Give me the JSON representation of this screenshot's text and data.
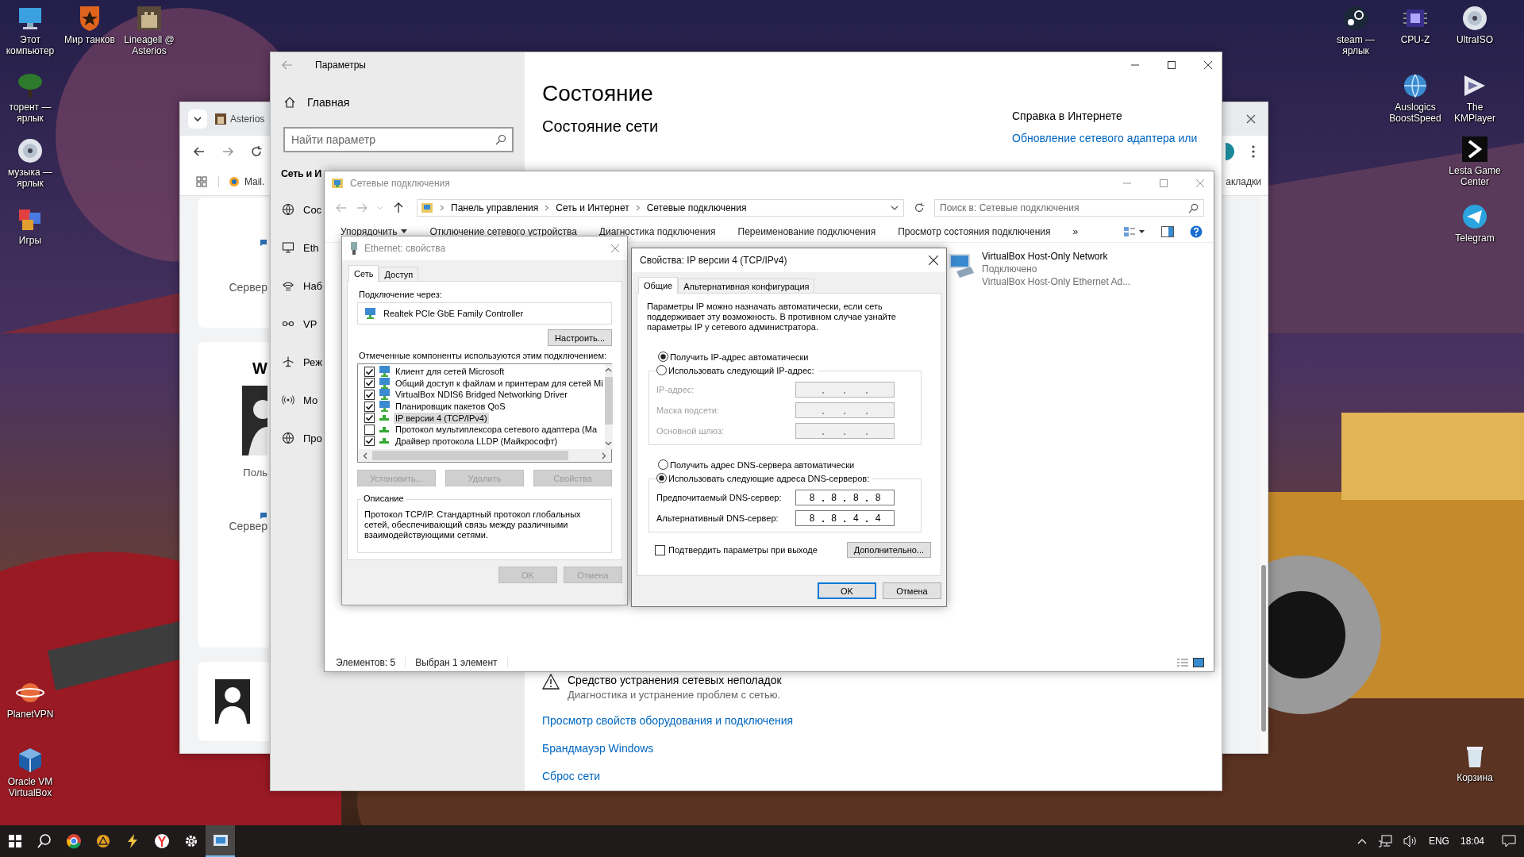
{
  "desktop_icons": [
    {
      "label": "Этот компьютер",
      "kind": "monitor"
    },
    {
      "label": "Мир танков",
      "kind": "star-shield"
    },
    {
      "label": "Lineagell @ Asterios",
      "kind": "castle"
    },
    {
      "label": "торент — ярлык",
      "kind": "tree"
    },
    {
      "label": "музыка — ярлык",
      "kind": "disc"
    },
    {
      "label": "Игры",
      "kind": "blocks"
    },
    {
      "label": "PlanetVPN",
      "kind": "planet"
    },
    {
      "label": "Oracle VM VirtualBox",
      "kind": "cube"
    },
    {
      "label": "steam — ярлык",
      "kind": "steam"
    },
    {
      "label": "CPU-Z",
      "kind": "chip"
    },
    {
      "label": "UltraISO",
      "kind": "disc"
    },
    {
      "label": "Auslogics BoostSpeed",
      "kind": "globe"
    },
    {
      "label": "The KMPlayer",
      "kind": "play"
    },
    {
      "label": "Lesta Game Center",
      "kind": "chevron"
    },
    {
      "label": "Telegram",
      "kind": "plane"
    },
    {
      "label": "Корзина",
      "kind": "bin"
    }
  ],
  "browser": {
    "tab": "Asterios",
    "bookmark": "Mail.",
    "bookmarks_end": "акладки",
    "cards": [
      {
        "server": "Сервер"
      },
      {
        "heading": "W",
        "user": "Поль",
        "server": "Сервер"
      }
    ]
  },
  "settings": {
    "title": "Параметры",
    "home": "Главная",
    "search_placeholder": "Найти параметр",
    "section": "Сеть и И",
    "nav": [
      {
        "label": "Сос",
        "kind": "globe"
      },
      {
        "label": "Eth",
        "kind": "ethernet"
      },
      {
        "label": "Наб",
        "kind": "dialup"
      },
      {
        "label": "VP",
        "kind": "vpn"
      },
      {
        "label": "Реж",
        "kind": "plane"
      },
      {
        "label": "Мо",
        "kind": "hotspot"
      },
      {
        "label": "Про",
        "kind": "globe"
      }
    ],
    "heading": "Состояние",
    "subheading": "Состояние сети",
    "help_title": "Справка в Интернете",
    "help_link": "Обновление сетевого адаптера или",
    "troubleshoot": {
      "title": "Средство устранения сетевых неполадок",
      "subtitle": "Диагностика и устранение проблем с сетью."
    },
    "links": [
      "Просмотр свойств оборудования и подключения",
      "Брандмауэр Windows",
      "Сброс сети"
    ]
  },
  "connections": {
    "title": "Сетевые подключения",
    "path": [
      "Панель управления",
      "Сеть и Интернет",
      "Сетевые подключения"
    ],
    "search_placeholder": "Поиск в: Сетевые подключения",
    "commands": [
      "Упорядочить",
      "Отключение сетевого устройства",
      "Диагностика подключения",
      "Переименование подключения",
      "Просмотр состояния подключения",
      "»"
    ],
    "item": {
      "name": "VirtualBox Host-Only Network",
      "status": "Подключено",
      "device": "VirtualBox Host-Only Ethernet Ad..."
    },
    "status": [
      "Элементов: 5",
      "Выбран 1 элемент"
    ]
  },
  "ethernet_dialog": {
    "title": "Ethernet: свойства",
    "tabs": [
      {
        "label": "Сеть",
        "selected": true
      },
      {
        "label": "Доступ",
        "selected": false
      }
    ],
    "connect_label": "Подключение через:",
    "adapter": "Realtek PCIe GbE Family Controller",
    "configure": "Настроить...",
    "components_label": "Отмеченные компоненты используются этим подключением:",
    "components": [
      {
        "name": "Клиент для сетей Microsoft",
        "kind": "client",
        "checked": true,
        "selected": false
      },
      {
        "name": "Общий доступ к файлам и принтерам для сетей Mi",
        "kind": "client",
        "checked": true,
        "selected": false
      },
      {
        "name": "VirtualBox NDIS6 Bridged Networking Driver",
        "kind": "client",
        "checked": true,
        "selected": false
      },
      {
        "name": "Планировщик пакетов QoS",
        "kind": "client",
        "checked": true,
        "selected": false
      },
      {
        "name": "IP версии 4 (TCP/IPv4)",
        "kind": "protocol",
        "checked": true,
        "selected": true
      },
      {
        "name": "Протокол мультиплексора сетевого адаптера (Ма",
        "kind": "protocol",
        "checked": false,
        "selected": false
      },
      {
        "name": "Драйвер протокола LLDP (Майкрософт)",
        "kind": "protocol",
        "checked": true,
        "selected": false
      }
    ],
    "buttons": [
      {
        "label": "Установить...",
        "disabled": true
      },
      {
        "label": "Удалить",
        "disabled": true
      },
      {
        "label": "Свойства",
        "disabled": true
      }
    ],
    "description_title": "Описание",
    "description": "Протокол TCP/IP. Стандартный протокол глобальных сетей, обеспечивающий связь между различными взаимодействующими сетями.",
    "footer": [
      {
        "label": "OK",
        "disabled": true
      },
      {
        "label": "Отмена",
        "disabled": true
      }
    ]
  },
  "ipv4_dialog": {
    "title": "Свойства: IP версии 4 (TCP/IPv4)",
    "tabs": [
      {
        "label": "Общие",
        "selected": true
      },
      {
        "label": "Альтернативная конфигурация",
        "selected": false
      }
    ],
    "intro": "Параметры IP можно назначать автоматически, если сеть поддерживает эту возможность. В противном случае узнайте параметры IP у сетевого администратора.",
    "ip_mode": [
      {
        "label": "Получить IP-адрес автоматически",
        "selected": true
      },
      {
        "label": "Использовать следующий IP-адрес:",
        "selected": false
      }
    ],
    "ip_fields": [
      {
        "label": "IP-адрес:",
        "disabled": true
      },
      {
        "label": "Маска подсети:",
        "disabled": true
      },
      {
        "label": "Основной шлюз:",
        "disabled": true
      }
    ],
    "dns_mode": [
      {
        "label": "Получить адрес DNS-сервера автоматически",
        "selected": false
      },
      {
        "label": "Использовать следующие адреса DNS-серверов:",
        "selected": true
      }
    ],
    "dns_fields": [
      {
        "label": "Предпочитаемый DNS-сервер:",
        "disabled": false,
        "octets": [
          "8",
          "8",
          "8",
          "8"
        ]
      },
      {
        "label": "Альтернативный DNS-сервер:",
        "disabled": false,
        "octets": [
          "8",
          "8",
          "4",
          "4"
        ]
      }
    ],
    "validate": {
      "label": "Подтвердить параметры при выходе",
      "checked": false
    },
    "advanced": "Дополнительно...",
    "buttons": [
      {
        "label": "OK",
        "focused": true
      },
      {
        "label": "Отмена",
        "focused": false
      }
    ]
  },
  "taskbar": {
    "apps": [
      {
        "kind": "windows",
        "active": false
      },
      {
        "kind": "search",
        "active": false
      },
      {
        "kind": "chrome",
        "active": false
      },
      {
        "kind": "aimp",
        "active": false
      },
      {
        "kind": "bolt",
        "active": false
      },
      {
        "kind": "yandex",
        "active": false
      },
      {
        "kind": "gear",
        "active": false
      },
      {
        "kind": "network-window",
        "active": true
      }
    ],
    "language": "ENG",
    "time": "18:04"
  }
}
